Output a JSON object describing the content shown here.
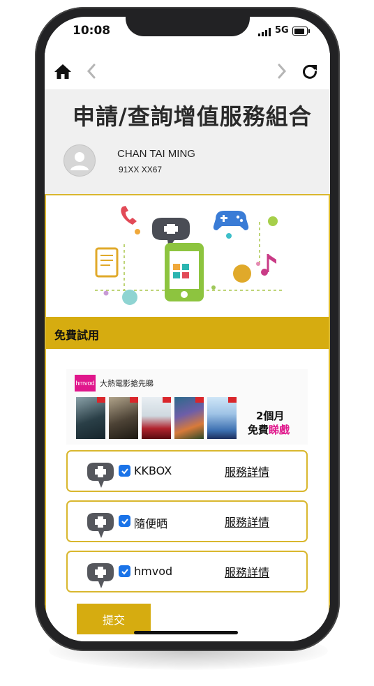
{
  "status_bar": {
    "time": "10:08",
    "network": "5G"
  },
  "page": {
    "title": "申請/查詢增值服務組合",
    "user_name": "CHAN TAI MING",
    "user_phone": "91XX XX67"
  },
  "trial_section": {
    "heading": "免費試用"
  },
  "promo_banner": {
    "logo_text": "hmvod",
    "tagline": "大熱電影搶先睇",
    "months_text": "2個月",
    "free_text": "免費",
    "watch_text": "睇戲"
  },
  "services": [
    {
      "name": "KKBOX",
      "detail_label": "服務詳情",
      "checked": true
    },
    {
      "name": "隨便晒",
      "detail_label": "服務詳情",
      "checked": true
    },
    {
      "name": "hmvod",
      "detail_label": "服務詳情",
      "checked": true
    }
  ],
  "submit_label": "提交",
  "colors": {
    "accent": "#d6ac10",
    "checkbox": "#1a73e8",
    "promo_pink": "#e0178c"
  }
}
